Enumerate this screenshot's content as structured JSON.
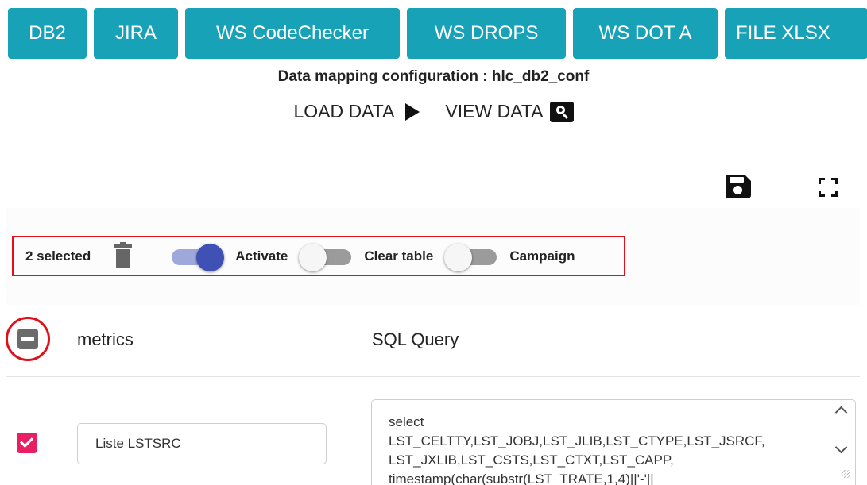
{
  "tabs": [
    {
      "label": "DB2"
    },
    {
      "label": "JIRA"
    },
    {
      "label": "WS CodeChecker"
    },
    {
      "label": "WS DROPS"
    },
    {
      "label": "WS DOT A"
    },
    {
      "label": "FILE XLSX"
    }
  ],
  "config_title": "Data mapping configuration : hlc_db2_conf",
  "actions": {
    "load_label": "LOAD DATA",
    "view_label": "VIEW DATA"
  },
  "toolbar": {
    "selected_count": "2 selected",
    "activate_label": "Activate",
    "activate_on": true,
    "clear_table_label": "Clear table",
    "clear_table_on": false,
    "campaign_label": "Campaign",
    "campaign_on": false
  },
  "table": {
    "columns": [
      "metrics",
      "SQL Query"
    ],
    "rows": [
      {
        "checked": true,
        "metric": "Liste LSTSRC",
        "sql": "select\nLST_CELTTY,LST_JOBJ,LST_JLIB,LST_CTYPE,LST_JSRCF,\nLST_JXLIB,LST_CSTS,LST_CTXT,LST_CAPP,\ntimestamp(char(substr(LST_TRATE,1,4)||'-'||"
      }
    ]
  },
  "colors": {
    "tab_bg": "#17a2b8",
    "highlight_red": "#e0101b",
    "toggle_on": "#3f51b5",
    "checkbox_pink": "#e91e63"
  },
  "icons": {
    "play": "play-icon",
    "search": "search-icon",
    "save": "save-icon",
    "fullscreen": "fullscreen-icon",
    "trash": "trash-icon"
  }
}
